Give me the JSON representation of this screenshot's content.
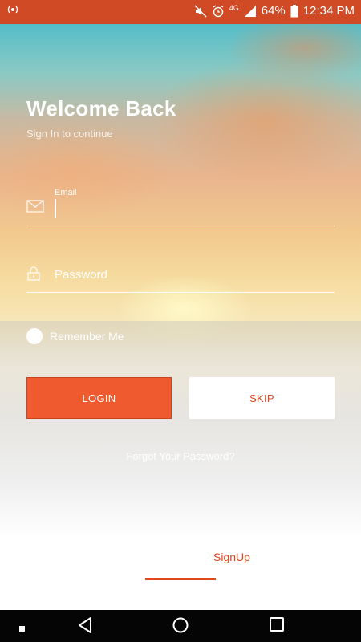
{
  "status_bar": {
    "battery": "64%",
    "time": "12:34 PM",
    "network": "4G",
    "icons": [
      "wireless-icon",
      "mute-icon",
      "alarm-icon",
      "network-4g-icon",
      "signal-icon",
      "battery-icon"
    ]
  },
  "header": {
    "title": "Welcome Back",
    "subtitle": "Sign In to continue"
  },
  "form": {
    "email_label": "Email",
    "email_value": "",
    "password_placeholder": "Password",
    "remember_label": "Remember Me"
  },
  "buttons": {
    "login": "LOGIN",
    "skip": "SKIP"
  },
  "forgot_link": "Forgot Your Password?",
  "tabs": {
    "signup": "SignUp"
  },
  "colors": {
    "accent": "#ef5a2f",
    "status_bar": "#cf4a25"
  }
}
